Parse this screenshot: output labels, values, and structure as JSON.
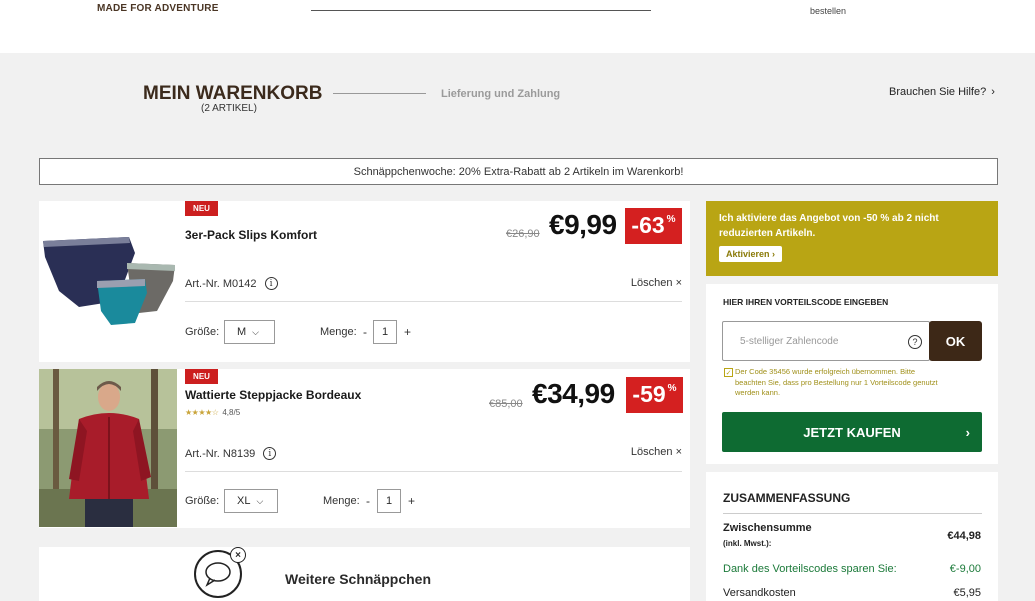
{
  "header": {
    "brand": "MADE FOR ADVENTURE",
    "bestellen": "bestellen"
  },
  "cart": {
    "title": "MEIN WARENKORB",
    "subtitle": "(2 ARTIKEL)",
    "step2": "Lieferung und Zahlung",
    "help": "Brauchen Sie Hilfe?",
    "help_chev": "›"
  },
  "promo_banner": "Schnäppchenwoche: 20% Extra-Rabatt ab 2 Artikeln im Warenkorb!",
  "items": [
    {
      "badge": "NEU",
      "name": "3er-Pack Slips Komfort",
      "old_price": "€26,90",
      "price": "€9,99",
      "discount": "-63",
      "pct": "%",
      "artnr": "Art.-Nr. M0142",
      "delete": "Löschen ×",
      "size_label": "Größe:",
      "size_value": "M",
      "qty_label": "Menge:",
      "qty_value": "1",
      "minus": "-",
      "plus": "+"
    },
    {
      "badge": "NEU",
      "name": "Wattierte Steppjacke Bordeaux",
      "rating_stars": "★★★★☆",
      "rating": "4,8/5",
      "old_price": "€85,00",
      "price": "€34,99",
      "discount": "-59",
      "pct": "%",
      "artnr": "Art.-Nr. N8139",
      "delete": "Löschen ×",
      "size_label": "Größe:",
      "size_value": "XL",
      "qty_label": "Menge:",
      "qty_value": "1",
      "minus": "-",
      "plus": "+"
    }
  ],
  "weitere": "Weitere Schnäppchen",
  "offer": {
    "text": "Ich aktiviere das Angebot von -50 % ab 2 nicht reduzierten Artikeln.",
    "button": "Aktivieren ›"
  },
  "voucher": {
    "heading": "HIER IHREN VORTEILSCODE EINGEBEN",
    "placeholder": "5-stelliger Zahlencode",
    "ok": "OK",
    "message": "Der Code 35456 wurde erfolgreich übernommen. Bitte beachten Sie, dass pro Bestellung nur 1 Vorteilscode genutzt werden kann.",
    "buy": "JETZT KAUFEN",
    "buy_chev": "›"
  },
  "summary": {
    "heading": "ZUSAMMENFASSUNG",
    "subtotal_label": "Zwischensumme",
    "subtotal_note": "(inkl. Mwst.):",
    "subtotal_value": "€44,98",
    "savings_label": "Dank des Vorteilscodes sparen Sie:",
    "savings_value": "€-9,00",
    "shipping_label": "Versandkosten",
    "shipping_value": "€5,95"
  },
  "colors": {
    "brand_brown": "#3b2a1c",
    "sale_red": "#d42020",
    "offer_gold": "#b9a514",
    "buy_green": "#0e6b32"
  }
}
